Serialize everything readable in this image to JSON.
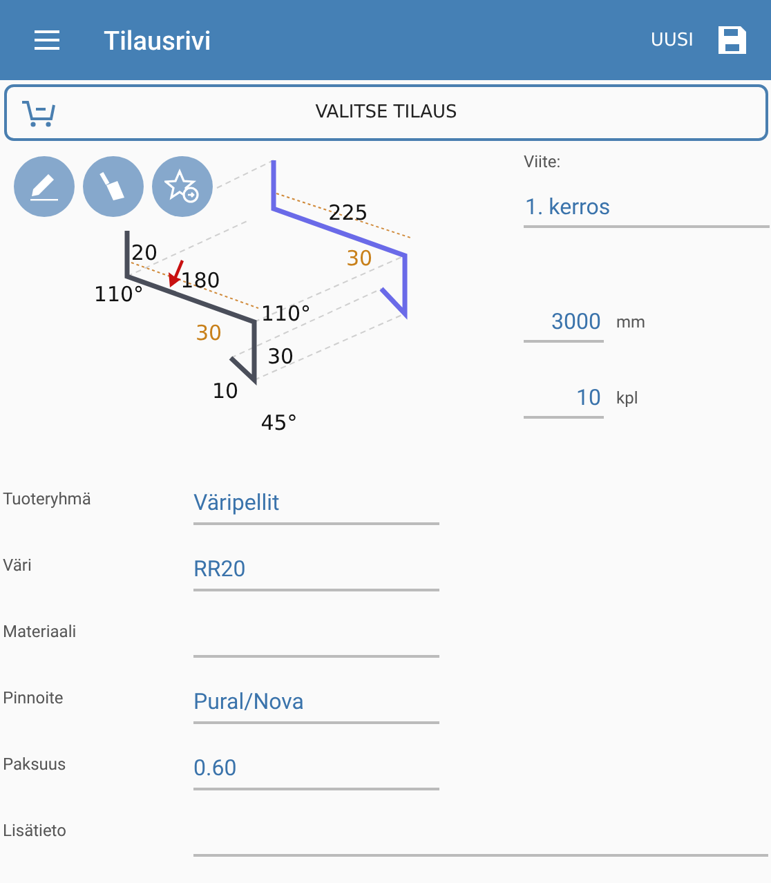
{
  "app_bar": {
    "title": "Tilausrivi",
    "action": "UUSI"
  },
  "select_order_button": "VALITSE TILAUS",
  "drawing": {
    "labels": [
      {
        "kind": "dimension",
        "text": "225"
      },
      {
        "kind": "fold",
        "text": "30"
      },
      {
        "kind": "dimension",
        "text": "20"
      },
      {
        "kind": "dimension",
        "text": "180"
      },
      {
        "kind": "angle",
        "text": "110°"
      },
      {
        "kind": "angle",
        "text": "110°"
      },
      {
        "kind": "fold",
        "text": "30"
      },
      {
        "kind": "dimension",
        "text": "30"
      },
      {
        "kind": "dimension",
        "text": "10"
      },
      {
        "kind": "angle",
        "text": "45°"
      }
    ]
  },
  "reference": {
    "label": "Viite:",
    "value": "1. kerros"
  },
  "length": {
    "value": "3000",
    "unit": "mm"
  },
  "quantity": {
    "value": "10",
    "unit": "kpl"
  },
  "fields": [
    {
      "kind": "normal",
      "label": "Tuoteryhmä",
      "value": "Väripellit"
    },
    {
      "kind": "normal",
      "label": "Väri",
      "value": "RR20"
    },
    {
      "kind": "normal",
      "label": "Materiaali"
    },
    {
      "kind": "normal",
      "label": "Pinnoite",
      "value": "Pural/Nova"
    },
    {
      "kind": "normal",
      "label": "Paksuus",
      "value": "0.60"
    },
    {
      "kind": "wide",
      "label": "Lisätieto"
    }
  ]
}
